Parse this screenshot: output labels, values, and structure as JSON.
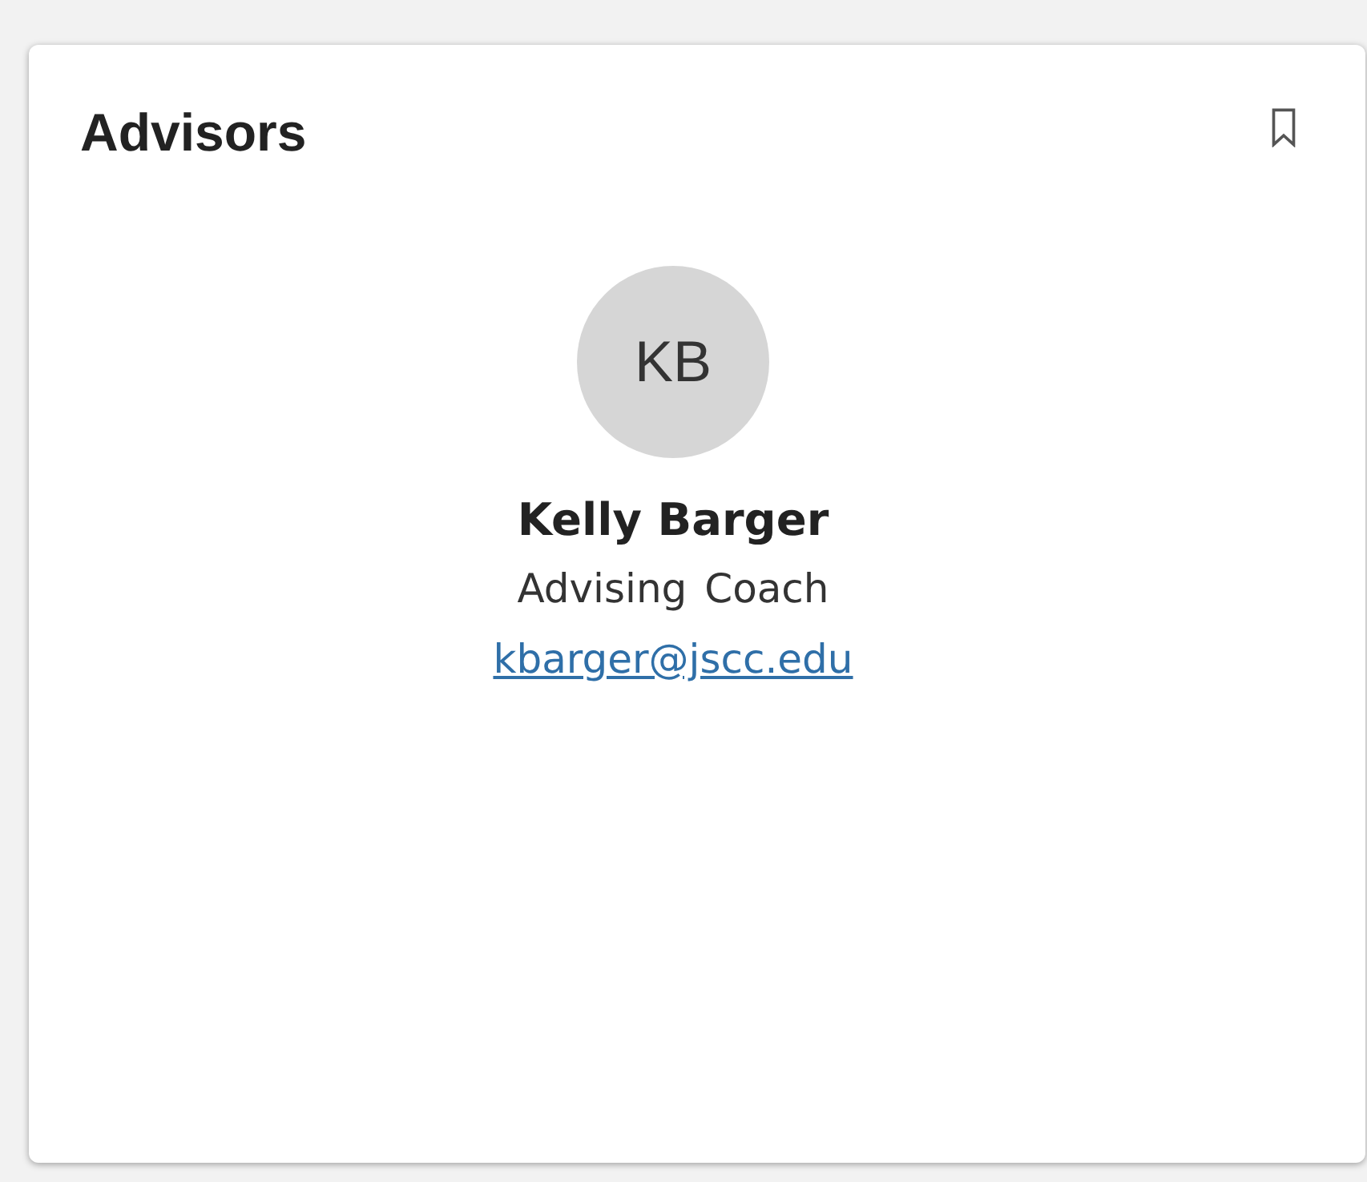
{
  "card": {
    "title": "Advisors",
    "bookmarked": false
  },
  "advisors": [
    {
      "initials": "KB",
      "name": "Kelly Barger",
      "role": "Advising Coach",
      "email": "kbarger@jscc.edu"
    }
  ]
}
